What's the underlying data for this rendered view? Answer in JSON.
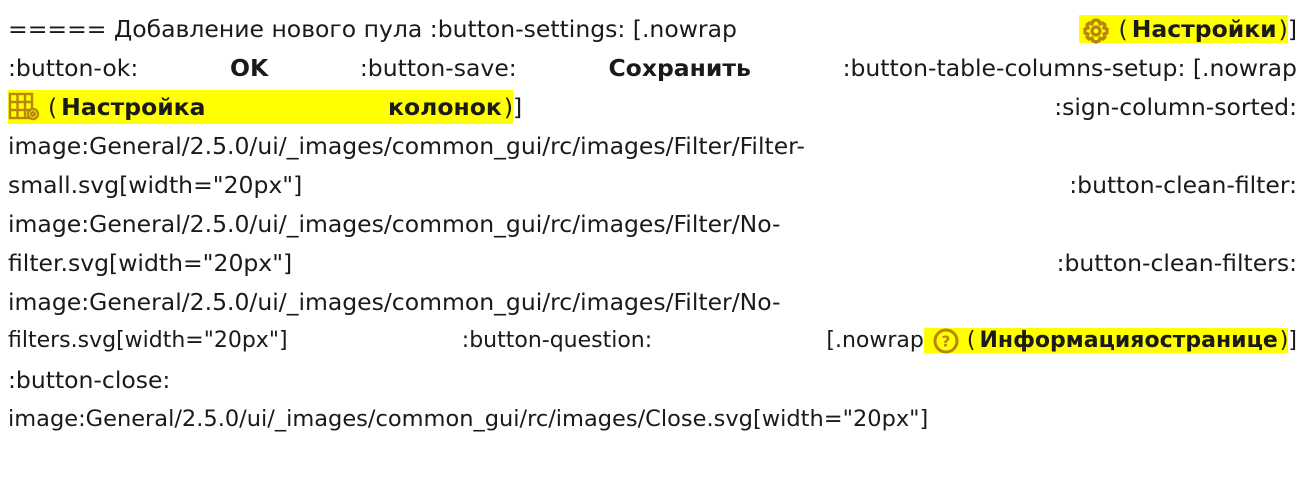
{
  "colors": {
    "highlight": "#ffff00",
    "icon": "#b8860b",
    "text": "#1a1a1a"
  },
  "lines": {
    "l1": {
      "a": "===== Добавление нового пула :button-settings: [.nowrap",
      "paren_open": "(",
      "label": "Настройки",
      "paren_close": ")",
      "tail": "]",
      "icon": "gear-icon"
    },
    "l2": {
      "a": ":button-ok:",
      "ok": "OK",
      "b": ":button-save:",
      "save": "Сохранить",
      "c": ":button-table-columns-setup: [.nowrap"
    },
    "l3": {
      "icon": "table-columns-setup-icon",
      "paren_open": "(",
      "word1": "Настройка",
      "word2": "колонок",
      "paren_close": ")",
      "tail": "]",
      "right": ":sign-column-sorted:"
    },
    "l4": "image:General/2.5.0/ui/_images/common_gui/rc/images/Filter/Filter-",
    "l5": {
      "left": "small.svg[width=\"20px\"]",
      "right": ":button-clean-filter:"
    },
    "l6": "image:General/2.5.0/ui/_images/common_gui/rc/images/Filter/No-",
    "l7": {
      "left": "filter.svg[width=\"20px\"]",
      "right": ":button-clean-filters:"
    },
    "l8": "image:General/2.5.0/ui/_images/common_gui/rc/images/Filter/No-",
    "l9": {
      "a": "filters.svg[width=\"20px\"]",
      "b": ":button-question:",
      "c": "[.nowrap",
      "icon": "question-icon",
      "paren_open": "(",
      "word1": "Информация",
      "word2": "о",
      "word3": "странице",
      "paren_close": ")",
      "tail": "]"
    },
    "l10": ":button-close:",
    "l11": "image:General/2.5.0/ui/_images/common_gui/rc/images/Close.svg[width=\"20px\"]"
  }
}
